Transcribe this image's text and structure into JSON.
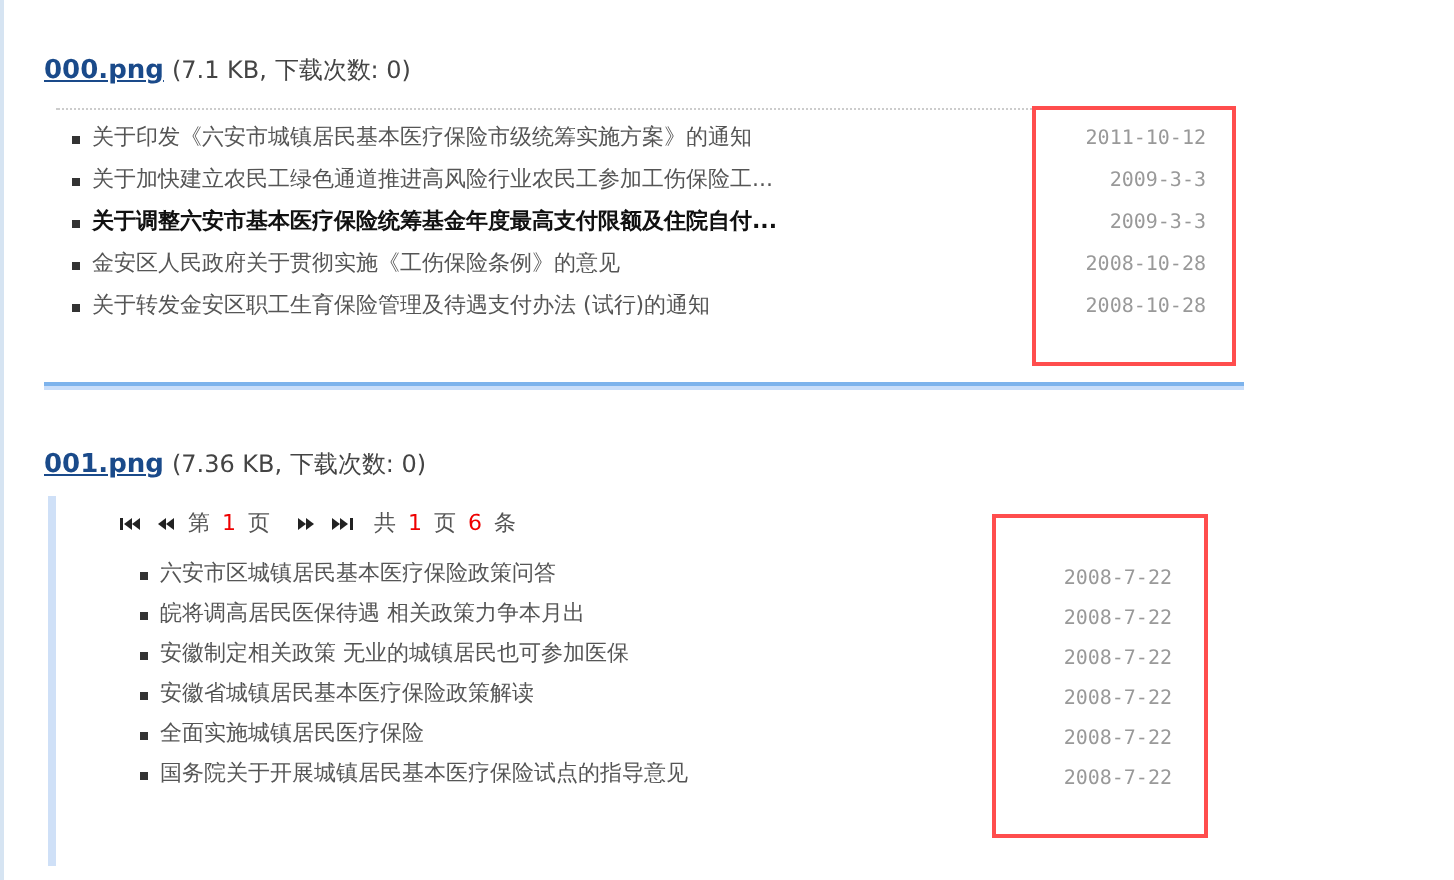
{
  "attachments": [
    {
      "kind": "plain",
      "file": "000.png",
      "info": "(7.1 KB, 下载次数: 0)",
      "items": [
        {
          "title": "关于印发《六安市城镇居民基本医疗保险市级统筹实施方案》的通知",
          "date": "2011-10-12",
          "emphasized": false
        },
        {
          "title": "关于加快建立农民工绿色通道推进高风险行业农民工参加工伤保险工...",
          "date": "2009-3-3",
          "emphasized": false
        },
        {
          "title": "关于调整六安市基本医疗保险统筹基金年度最高支付限额及住院自付...",
          "date": "2009-3-3",
          "emphasized": true
        },
        {
          "title": "金安区人民政府关于贯彻实施《工伤保险条例》的意见",
          "date": "2008-10-28",
          "emphasized": false
        },
        {
          "title": "关于转发金安区职工生育保险管理及待遇支付办法 (试行)的通知",
          "date": "2008-10-28",
          "emphasized": false
        }
      ]
    },
    {
      "kind": "paged",
      "file": "001.png",
      "info": "(7.36 KB, 下载次数: 0)",
      "pager": {
        "before": "第",
        "page": "1",
        "page_unit": "页",
        "total_label": "共",
        "total_pages": "1",
        "total_unit": "页",
        "count": "6",
        "count_unit": "条"
      },
      "items": [
        {
          "title": "六安市区城镇居民基本医疗保险政策问答",
          "date": "2008-7-22",
          "emphasized": false
        },
        {
          "title": "皖将调高居民医保待遇 相关政策力争本月出",
          "date": "2008-7-22",
          "emphasized": false
        },
        {
          "title": "安徽制定相关政策 无业的城镇居民也可参加医保",
          "date": "2008-7-22",
          "emphasized": false
        },
        {
          "title": "安徽省城镇居民基本医疗保险政策解读",
          "date": "2008-7-22",
          "emphasized": false
        },
        {
          "title": "全面实施城镇居民医疗保险",
          "date": "2008-7-22",
          "emphasized": false
        },
        {
          "title": "国务院关于开展城镇居民基本医疗保险试点的指导意见",
          "date": "2008-7-22",
          "emphasized": false
        }
      ]
    }
  ]
}
